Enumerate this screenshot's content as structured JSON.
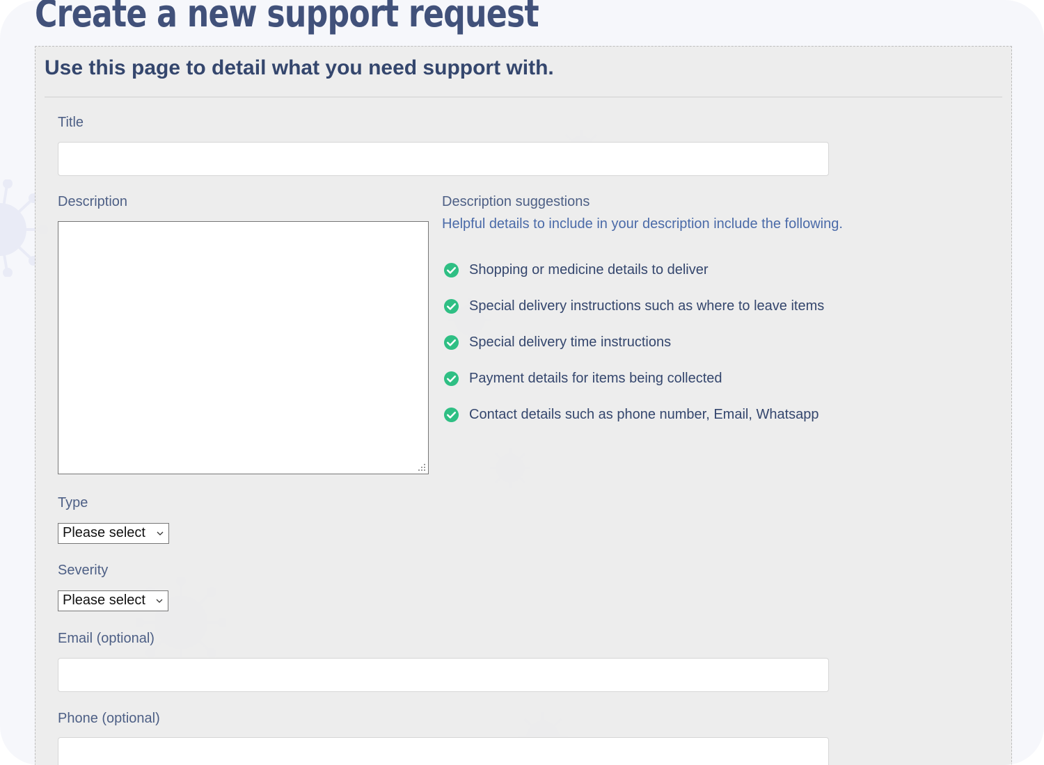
{
  "page": {
    "title": "Create a new support request"
  },
  "panel": {
    "heading": "Use this page to detail what you need support with."
  },
  "form": {
    "title_label": "Title",
    "title_value": "",
    "description_label": "Description",
    "description_value": "",
    "type_label": "Type",
    "type_selected": "Please select",
    "severity_label": "Severity",
    "severity_selected": "Please select",
    "email_label": "Email (optional)",
    "email_value": "",
    "phone_label": "Phone (optional)",
    "phone_value": ""
  },
  "suggestions": {
    "title": "Description suggestions",
    "intro": "Helpful details to include in your description include the following.",
    "items": [
      "Shopping or medicine details to deliver",
      "Special delivery instructions such as where to leave items",
      "Special delivery time instructions",
      "Payment details for items being collected",
      "Contact details such as phone number, Email, Whatsapp"
    ],
    "icon": "check-circle-icon"
  },
  "colors": {
    "heading": "#41517a",
    "label": "#4d5f85",
    "check": "#2fbf84",
    "panel_background": "#ececec"
  }
}
